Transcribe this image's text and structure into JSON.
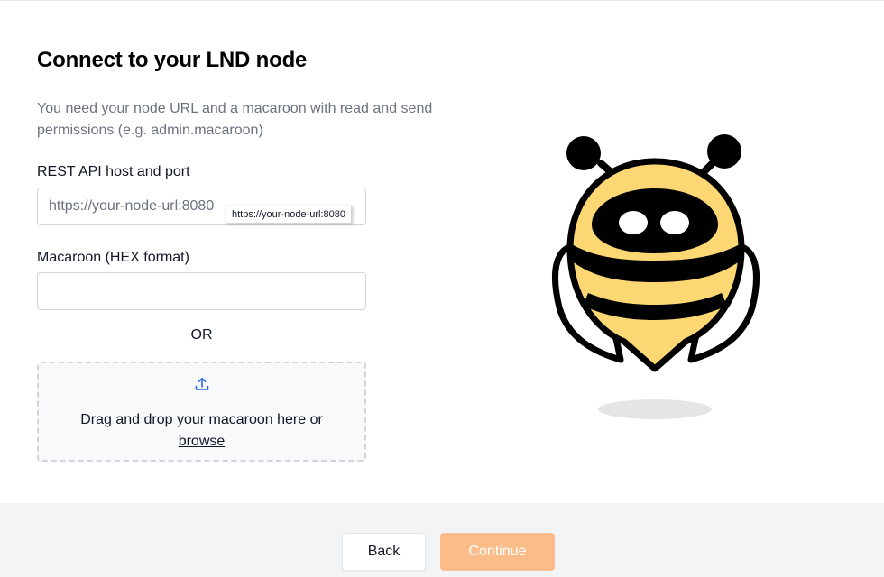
{
  "page": {
    "title": "Connect to your LND node",
    "description": "You need your node URL and a macaroon with read and send permissions (e.g. admin.macaroon)"
  },
  "host_field": {
    "label": "REST API host and port",
    "placeholder": "https://your-node-url:8080",
    "value": "",
    "tooltip": "https://your-node-url:8080"
  },
  "macaroon_field": {
    "label": "Macaroon (HEX format)",
    "placeholder": "",
    "value": ""
  },
  "separator": "OR",
  "dropzone": {
    "icon": "upload-icon",
    "text": "Drag and drop your macaroon here or",
    "browse_label": "browse"
  },
  "illustration": {
    "icon": "bee-mascot"
  },
  "footer": {
    "back_label": "Back",
    "continue_label": "Continue"
  },
  "colors": {
    "accent_disabled": "#fcbc8a",
    "bee_yellow": "#fcd773",
    "upload_icon_blue": "#2563eb"
  }
}
